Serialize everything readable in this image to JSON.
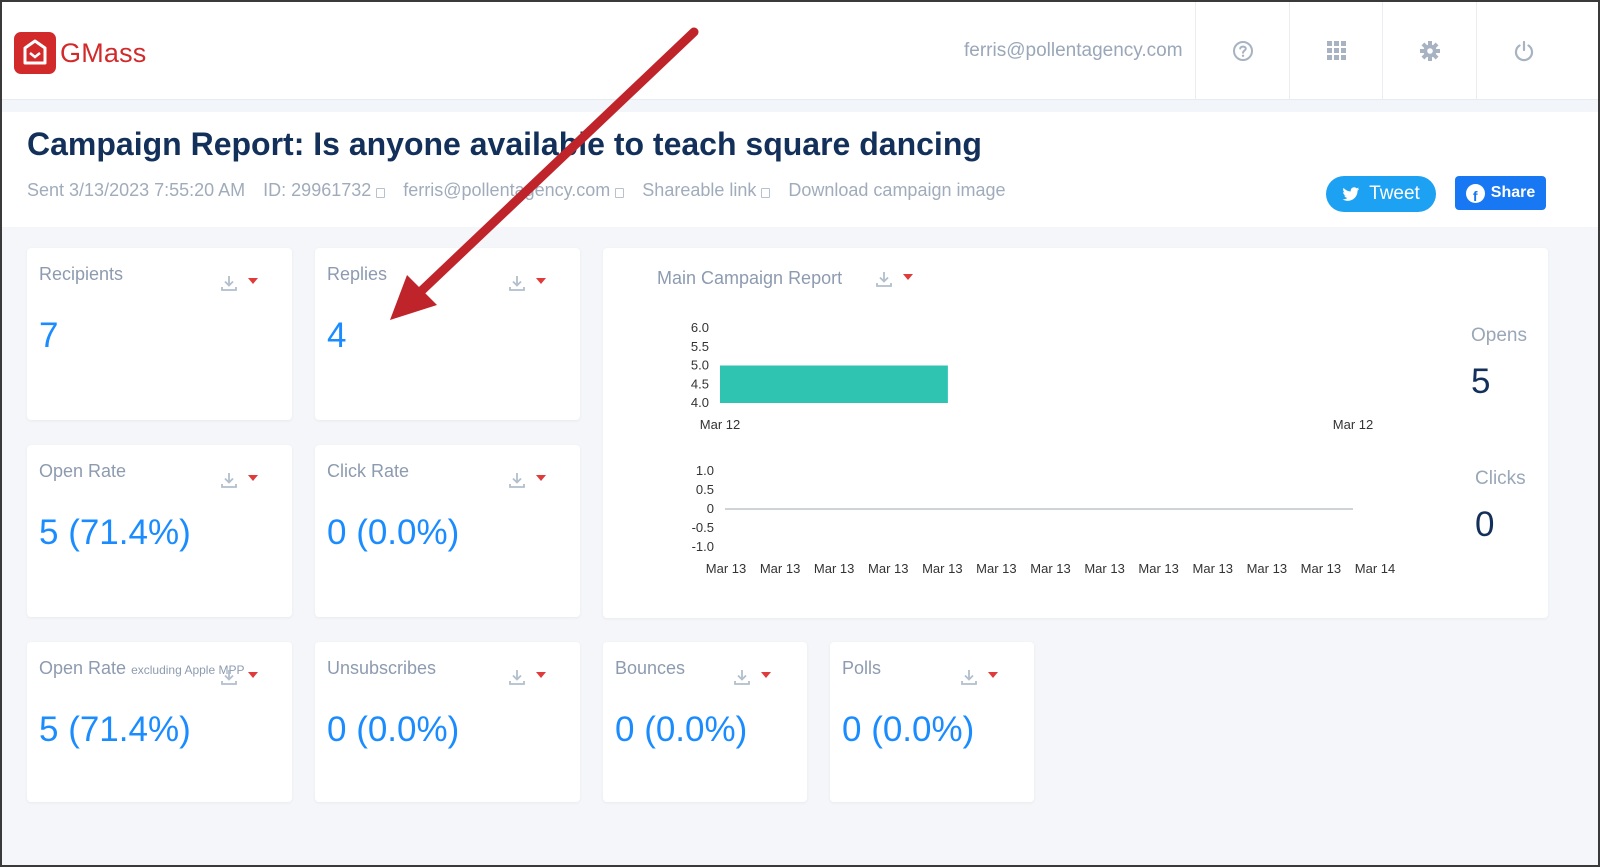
{
  "header": {
    "brand": "GMass",
    "user_email": "ferris@pollentagency.com",
    "icons": [
      "help-icon",
      "apps-grid-icon",
      "settings-gear-icon",
      "power-icon"
    ]
  },
  "report": {
    "title": "Campaign Report: Is anyone available to teach square dancing",
    "sent": "Sent 3/13/2023 7:55:20 AM",
    "id": "ID: 29961732",
    "email": "ferris@pollentagency.com",
    "shareable_link": "Shareable link",
    "download_image": "Download campaign image",
    "tweet_label": "Tweet",
    "share_label": "Share"
  },
  "cards": {
    "recipients": {
      "title": "Recipients",
      "value": "7"
    },
    "replies": {
      "title": "Replies",
      "value": "4"
    },
    "open_rate": {
      "title": "Open Rate",
      "value": "5 (71.4%)"
    },
    "click_rate": {
      "title": "Click Rate",
      "value": "0 (0.0%)"
    },
    "open_rate_mpp": {
      "title": "Open Rate",
      "subtitle": "excluding Apple MPP",
      "value": "5 (71.4%)"
    },
    "unsubscribes": {
      "title": "Unsubscribes",
      "value": "0 (0.0%)"
    },
    "bounces": {
      "title": "Bounces",
      "value": "0 (0.0%)"
    },
    "polls": {
      "title": "Polls",
      "value": "0 (0.0%)"
    }
  },
  "main_report": {
    "title": "Main Campaign Report",
    "opens_label": "Opens",
    "opens_value": "5",
    "clicks_label": "Clicks",
    "clicks_value": "0"
  },
  "chart_data": [
    {
      "type": "bar",
      "series": [
        {
          "values": [
            5
          ]
        }
      ],
      "x_tick_labels": [
        "Mar 12",
        "Mar 12"
      ],
      "y_ticks": [
        "6.0",
        "5.5",
        "5.0",
        "4.5",
        "4.0"
      ],
      "ylim": [
        4.0,
        6.0
      ],
      "bar_span": [
        0,
        0.36
      ],
      "color": "#2ec4b1"
    },
    {
      "type": "line",
      "series": [
        {
          "values": [
            0,
            0
          ]
        }
      ],
      "x_tick_labels": [
        "Mar 13",
        "Mar 13",
        "Mar 13",
        "Mar 13",
        "Mar 13",
        "Mar 13",
        "Mar 13",
        "Mar 13",
        "Mar 13",
        "Mar 13",
        "Mar 13",
        "Mar 13",
        "Mar 14"
      ],
      "y_ticks": [
        "1.0",
        "0.5",
        "0",
        "-0.5",
        "-1.0"
      ],
      "ylim": [
        -1.0,
        1.0
      ]
    }
  ],
  "colors": {
    "accent_blue": "#1a8cff",
    "brand_red": "#d22a2a",
    "title_navy": "#13305a",
    "annotation_arrow": "#c0242b"
  }
}
